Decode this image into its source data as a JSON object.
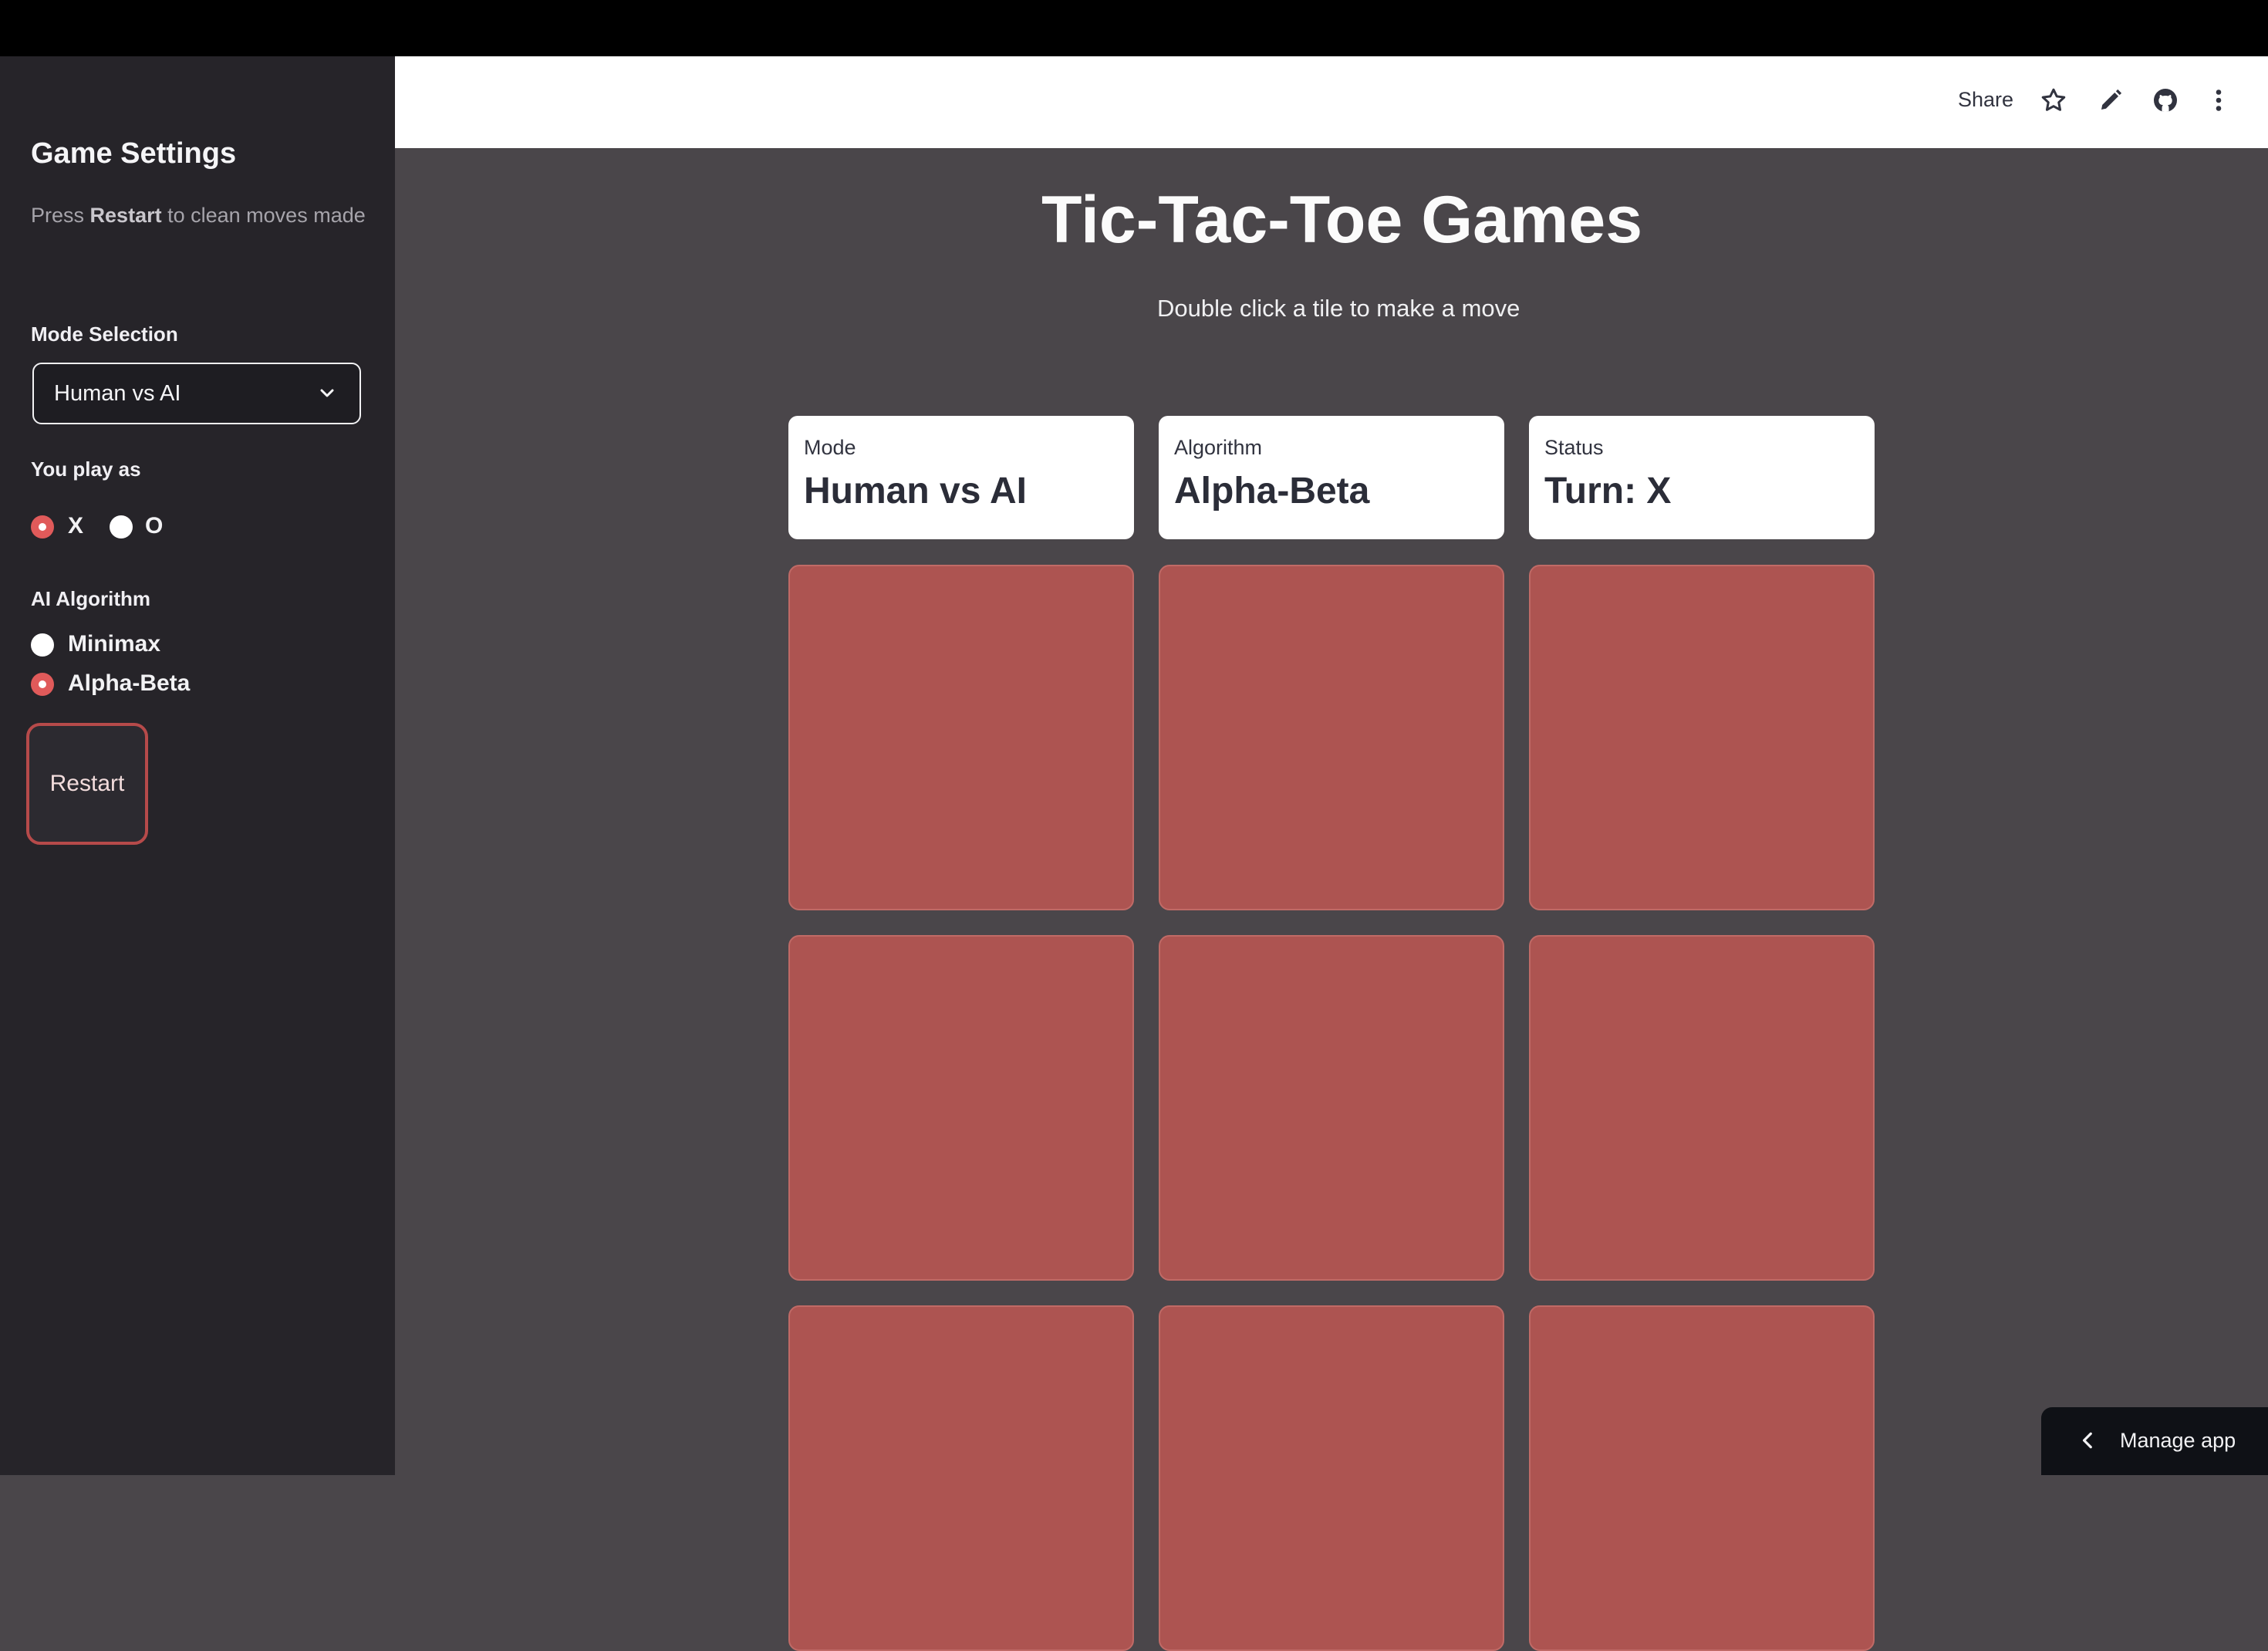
{
  "sidebar": {
    "title": "Game Settings",
    "caption_prefix": "Press",
    "caption_bold": "Restart",
    "caption_suffix": "to clean moves made",
    "mode_label": "Mode Selection",
    "mode_value": "Human vs AI",
    "play_as_label": "You play as",
    "play_as_options": [
      {
        "label": "X",
        "selected": true
      },
      {
        "label": "O",
        "selected": false
      }
    ],
    "algo_label": "AI Algorithm",
    "algo_options": [
      {
        "label": "Minimax",
        "selected": false
      },
      {
        "label": "Alpha-Beta",
        "selected": true
      }
    ],
    "restart_label": "Restart"
  },
  "header": {
    "share_label": "Share",
    "icons": [
      "star-icon",
      "pencil-icon",
      "github-icon",
      "more-vertical-icon"
    ]
  },
  "main": {
    "title": "Tic-Tac-Toe Games",
    "subtitle": "Double click a tile to make a move",
    "metrics": [
      {
        "label": "Mode",
        "value": "Human vs AI"
      },
      {
        "label": "Algorithm",
        "value": "Alpha-Beta"
      },
      {
        "label": "Status",
        "value": "Turn: X"
      }
    ],
    "board": [
      "",
      "",
      "",
      "",
      "",
      "",
      "",
      "",
      ""
    ]
  },
  "manage_app": {
    "label": "Manage app"
  },
  "colors": {
    "sidebar_bg": "#262429",
    "main_bg": "#4a464a",
    "tile": "#ad5451",
    "accent": "#e05a5a"
  }
}
